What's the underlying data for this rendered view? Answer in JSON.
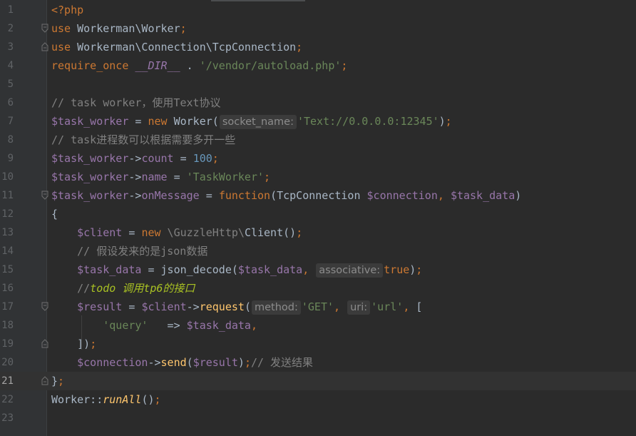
{
  "editor": {
    "lines": [
      {
        "n": "1",
        "tokens": [
          {
            "t": "<?php",
            "c": "kw"
          }
        ]
      },
      {
        "n": "2",
        "fold": "start",
        "tokens": [
          {
            "t": "use",
            "c": "kw"
          },
          {
            "t": " Workerman\\Worker",
            "c": ""
          },
          {
            "t": ";",
            "c": "kw"
          }
        ]
      },
      {
        "n": "3",
        "fold": "end",
        "tokens": [
          {
            "t": "use",
            "c": "kw"
          },
          {
            "t": " Workerman\\Connection\\TcpConnection",
            "c": ""
          },
          {
            "t": ";",
            "c": "kw"
          }
        ]
      },
      {
        "n": "4",
        "tokens": [
          {
            "t": "require_once",
            "c": "kw"
          },
          {
            "t": " ",
            "c": ""
          },
          {
            "t": "__DIR__",
            "c": "const"
          },
          {
            "t": " . ",
            "c": ""
          },
          {
            "t": "'/vendor/autoload.php'",
            "c": "str"
          },
          {
            "t": ";",
            "c": "kw"
          }
        ]
      },
      {
        "n": "5",
        "tokens": []
      },
      {
        "n": "6",
        "tokens": [
          {
            "t": "// task worker，使用Text协议",
            "c": "cmt"
          }
        ]
      },
      {
        "n": "7",
        "tokens": [
          {
            "t": "$task_worker",
            "c": "var"
          },
          {
            "t": " = ",
            "c": ""
          },
          {
            "t": "new",
            "c": "kw"
          },
          {
            "t": " Worker(",
            "c": ""
          },
          {
            "t": "socket_name:",
            "c": "hint"
          },
          {
            "t": "'Text://0.0.0.0:12345'",
            "c": "str"
          },
          {
            "t": ")",
            "c": ""
          },
          {
            "t": ";",
            "c": "kw"
          }
        ]
      },
      {
        "n": "8",
        "tokens": [
          {
            "t": "// task进程数可以根据需要多开一些",
            "c": "cmt"
          }
        ]
      },
      {
        "n": "9",
        "tokens": [
          {
            "t": "$task_worker",
            "c": "var"
          },
          {
            "t": "->",
            "c": ""
          },
          {
            "t": "count",
            "c": "var"
          },
          {
            "t": " = ",
            "c": ""
          },
          {
            "t": "100",
            "c": "num"
          },
          {
            "t": ";",
            "c": "kw"
          }
        ]
      },
      {
        "n": "10",
        "tokens": [
          {
            "t": "$task_worker",
            "c": "var"
          },
          {
            "t": "->",
            "c": ""
          },
          {
            "t": "name",
            "c": "var"
          },
          {
            "t": " = ",
            "c": ""
          },
          {
            "t": "'TaskWorker'",
            "c": "str"
          },
          {
            "t": ";",
            "c": "kw"
          }
        ]
      },
      {
        "n": "11",
        "fold": "start",
        "tokens": [
          {
            "t": "$task_worker",
            "c": "var"
          },
          {
            "t": "->",
            "c": ""
          },
          {
            "t": "onMessage",
            "c": "var"
          },
          {
            "t": " = ",
            "c": ""
          },
          {
            "t": "function",
            "c": "kw"
          },
          {
            "t": "(TcpConnection ",
            "c": ""
          },
          {
            "t": "$connection",
            "c": "var"
          },
          {
            "t": ", ",
            "c": "kw"
          },
          {
            "t": "$task_data",
            "c": "var"
          },
          {
            "t": ")",
            "c": ""
          }
        ]
      },
      {
        "n": "12",
        "tokens": [
          {
            "t": "{",
            "c": ""
          }
        ]
      },
      {
        "n": "13",
        "tokens": [
          {
            "t": "    ",
            "c": ""
          },
          {
            "t": "$client",
            "c": "var"
          },
          {
            "t": " = ",
            "c": ""
          },
          {
            "t": "new",
            "c": "kw"
          },
          {
            "t": " \\GuzzleHttp\\",
            "c": "cmt"
          },
          {
            "t": "Client()",
            "c": ""
          },
          {
            "t": ";",
            "c": "kw"
          }
        ]
      },
      {
        "n": "14",
        "tokens": [
          {
            "t": "    // 假设发来的是json数据",
            "c": "cmt"
          }
        ]
      },
      {
        "n": "15",
        "tokens": [
          {
            "t": "    ",
            "c": ""
          },
          {
            "t": "$task_data",
            "c": "var"
          },
          {
            "t": " = json_decode(",
            "c": ""
          },
          {
            "t": "$task_data",
            "c": "var"
          },
          {
            "t": ", ",
            "c": "kw"
          },
          {
            "t": "associative:",
            "c": "hint"
          },
          {
            "t": "true",
            "c": "kw"
          },
          {
            "t": ")",
            "c": ""
          },
          {
            "t": ";",
            "c": "kw"
          }
        ]
      },
      {
        "n": "16",
        "tokens": [
          {
            "t": "    //",
            "c": "cmt"
          },
          {
            "t": "todo 调用tp6的接口",
            "c": "todo"
          }
        ]
      },
      {
        "n": "17",
        "fold": "start",
        "tokens": [
          {
            "t": "    ",
            "c": ""
          },
          {
            "t": "$result",
            "c": "var"
          },
          {
            "t": " = ",
            "c": ""
          },
          {
            "t": "$client",
            "c": "var"
          },
          {
            "t": "->",
            "c": ""
          },
          {
            "t": "request",
            "c": "fn"
          },
          {
            "t": "(",
            "c": ""
          },
          {
            "t": "method:",
            "c": "hint"
          },
          {
            "t": "'GET'",
            "c": "str"
          },
          {
            "t": ", ",
            "c": "kw"
          },
          {
            "t": "uri:",
            "c": "hint"
          },
          {
            "t": "'url'",
            "c": "str"
          },
          {
            "t": ", ",
            "c": "kw"
          },
          {
            "t": "[",
            "c": ""
          }
        ]
      },
      {
        "n": "18",
        "tokens": [
          {
            "t": "        ",
            "c": ""
          },
          {
            "t": "'query'",
            "c": "str"
          },
          {
            "t": "   => ",
            "c": ""
          },
          {
            "t": "$task_data",
            "c": "var"
          },
          {
            "t": ",",
            "c": "kw"
          }
        ]
      },
      {
        "n": "19",
        "fold": "end",
        "tokens": [
          {
            "t": "    ])",
            "c": ""
          },
          {
            "t": ";",
            "c": "kw"
          }
        ]
      },
      {
        "n": "20",
        "tokens": [
          {
            "t": "    ",
            "c": ""
          },
          {
            "t": "$connection",
            "c": "var"
          },
          {
            "t": "->",
            "c": ""
          },
          {
            "t": "send",
            "c": "fn"
          },
          {
            "t": "(",
            "c": ""
          },
          {
            "t": "$result",
            "c": "var"
          },
          {
            "t": ")",
            "c": ""
          },
          {
            "t": ";",
            "c": "kw"
          },
          {
            "t": "// 发送结果",
            "c": "cmt"
          }
        ]
      },
      {
        "n": "21",
        "fold": "end",
        "current": true,
        "tokens": [
          {
            "t": "}",
            "c": ""
          },
          {
            "t": ";",
            "c": "kw"
          }
        ]
      },
      {
        "n": "22",
        "tokens": [
          {
            "t": "Worker::",
            "c": ""
          },
          {
            "t": "runAll",
            "c": "static"
          },
          {
            "t": "()",
            "c": ""
          },
          {
            "t": ";",
            "c": "kw"
          }
        ]
      },
      {
        "n": "23",
        "tokens": []
      }
    ]
  }
}
